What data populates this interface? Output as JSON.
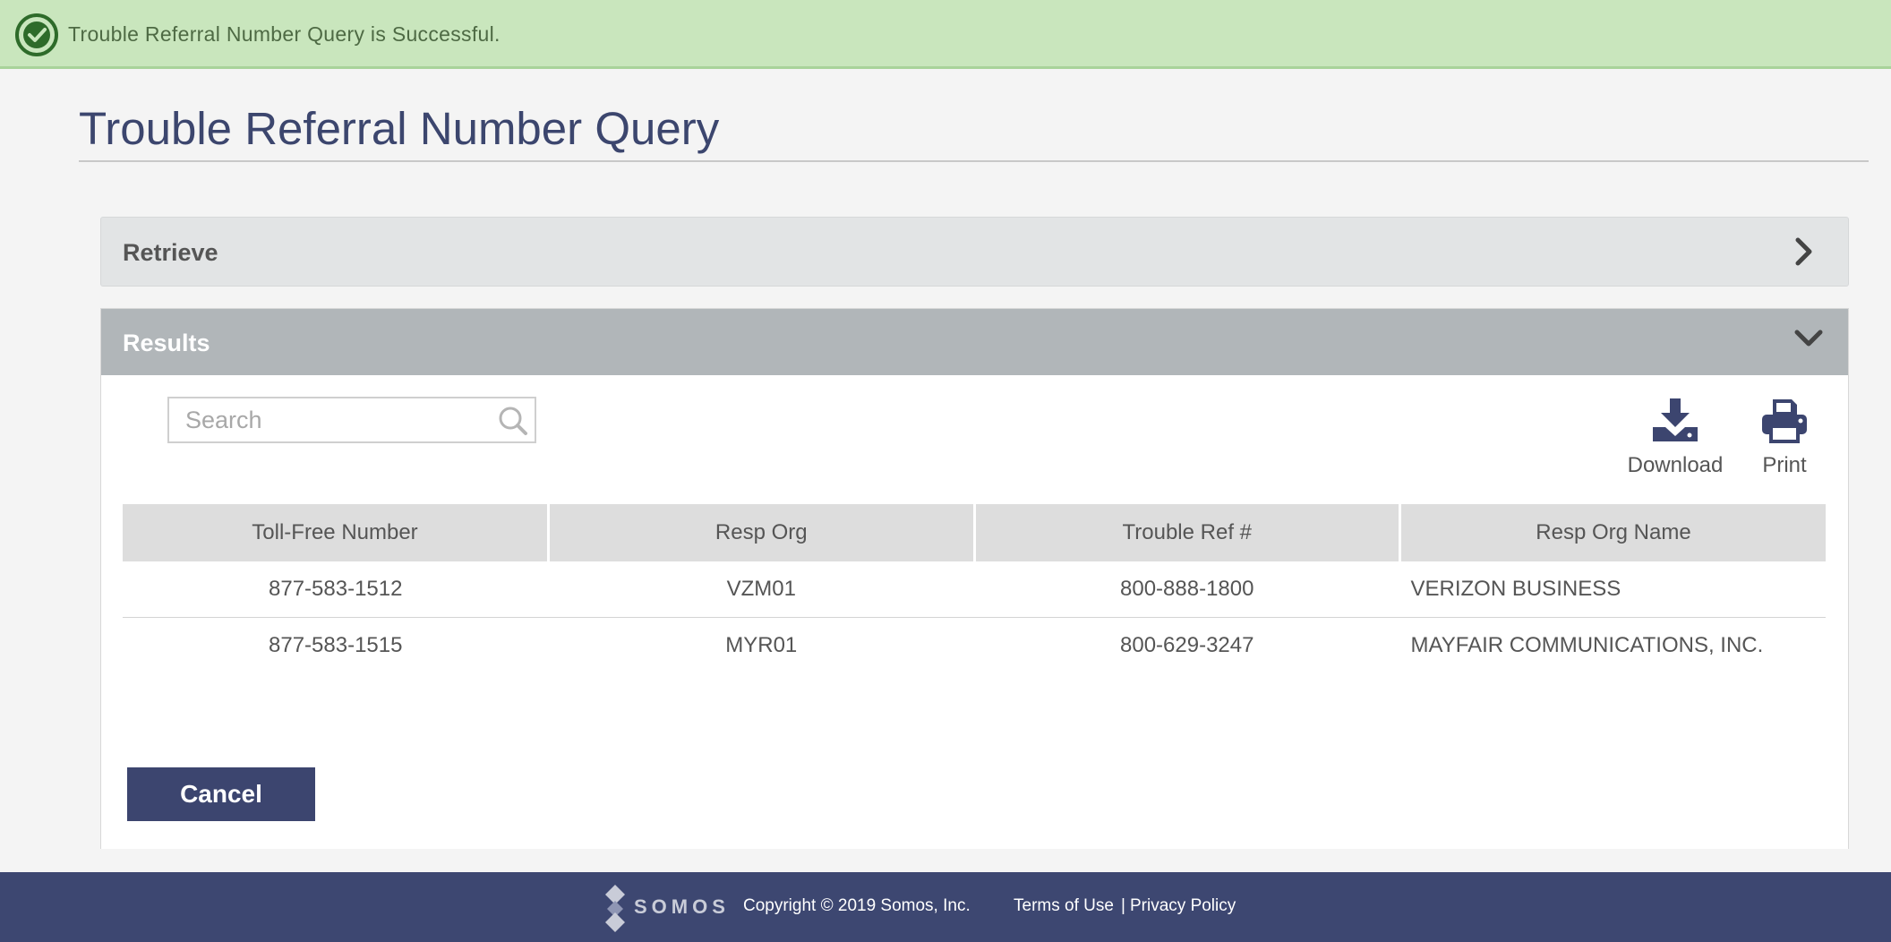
{
  "banner": {
    "message": "Trouble Referral Number Query is Successful."
  },
  "page": {
    "title": "Trouble Referral Number Query"
  },
  "retrieve_panel": {
    "label": "Retrieve"
  },
  "results_panel": {
    "label": "Results",
    "search": {
      "placeholder": "Search",
      "value": ""
    },
    "actions": {
      "download": "Download",
      "print": "Print"
    },
    "table": {
      "columns": [
        "Toll-Free Number",
        "Resp Org",
        "Trouble Ref #",
        "Resp Org Name"
      ],
      "rows": [
        [
          "877-583-1512",
          "VZM01",
          "800-888-1800",
          "VERIZON BUSINESS"
        ],
        [
          "877-583-1515",
          "MYR01",
          "800-629-3247",
          "MAYFAIR COMMUNICATIONS, INC."
        ]
      ]
    },
    "cancel_label": "Cancel"
  },
  "footer": {
    "logo_text": "SOMOS",
    "copyright": "Copyright © 2019 Somos, Inc.",
    "terms": "Terms of Use",
    "separator": "|",
    "privacy": "Privacy Policy"
  },
  "colors": {
    "success_bg": "#c9e6bd",
    "success_icon": "#2e6b2a",
    "brand_navy": "#3c456f",
    "results_header": "#b1b6b9",
    "retrieve_header": "#e2e4e5"
  },
  "icons": {
    "banner": "check-circle-icon",
    "retrieve": "chevron-right-icon",
    "results": "chevron-down-icon",
    "search": "search-icon",
    "download": "download-icon",
    "print": "printer-icon",
    "logo": "somos-logo-icon"
  }
}
